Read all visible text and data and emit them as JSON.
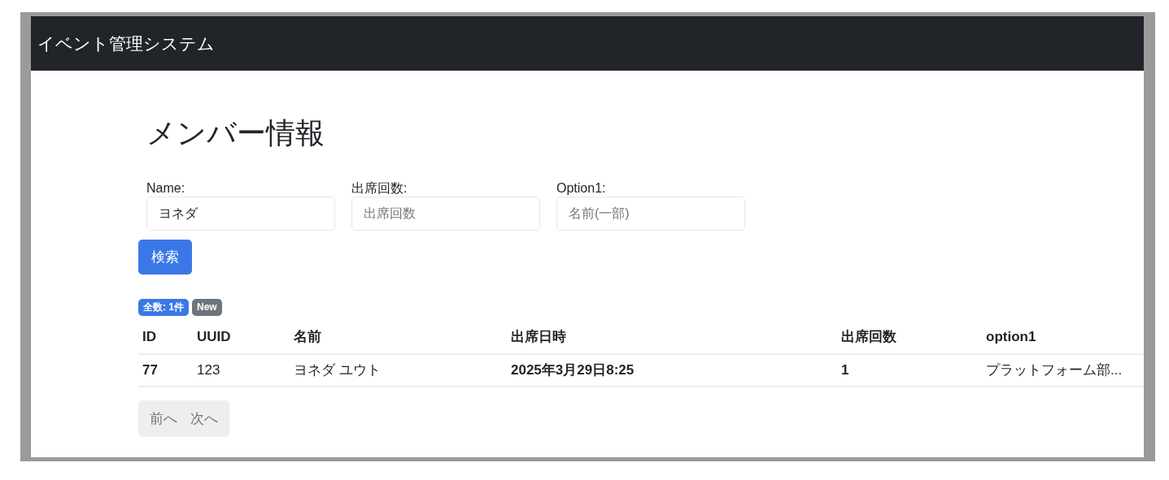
{
  "navbar": {
    "title": "イベント管理システム"
  },
  "page_title": "メンバー情報",
  "filters": [
    {
      "label": "Name:",
      "value": "ヨネダ"
    },
    {
      "label": "出席回数:",
      "placeholder": "出席回数"
    },
    {
      "label": "Option1:",
      "placeholder": "名前(一部)"
    }
  ],
  "search_button": "検索",
  "badges": [
    {
      "text": "全数: 1件",
      "color": "#3b78e7"
    },
    {
      "text": "New",
      "color": "#6c757d"
    }
  ],
  "table": {
    "columns": [
      "ID",
      "UUID",
      "名前",
      "出席日時",
      "出席回数",
      "option1"
    ],
    "rows": [
      [
        "77",
        "123",
        "ヨネダ ユウト",
        "2025年3月29日8:25",
        "1",
        "プラットフォーム部..."
      ]
    ]
  },
  "pagination": [
    {
      "label": "前へ",
      "disabled": true
    },
    {
      "label": "次へ",
      "disabled": true
    }
  ]
}
